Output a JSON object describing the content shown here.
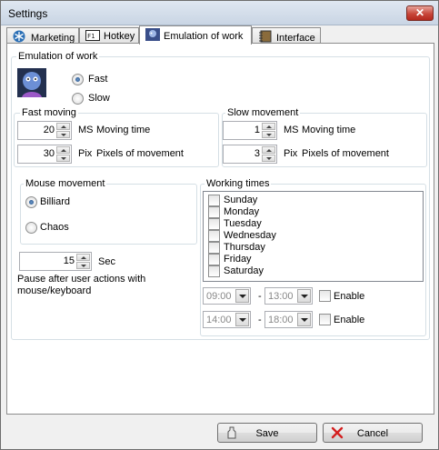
{
  "window": {
    "title": "Settings",
    "close_glyph": "✕"
  },
  "tabs": [
    {
      "label": "Marketing",
      "icon": "snowflake-icon"
    },
    {
      "label": "Hotkey",
      "icon": "keyboard-icon"
    },
    {
      "label": "Emulation of work",
      "icon": "robot-icon",
      "active": true
    },
    {
      "label": "Interface",
      "icon": "notebook-icon"
    }
  ],
  "emulation": {
    "title": "Emulation of work",
    "fast_label": "Fast",
    "slow_label": "Slow",
    "selected": "Fast"
  },
  "fast_moving": {
    "title": "Fast moving",
    "time_value": "20",
    "time_unit": "MS",
    "time_label": "Moving time",
    "pixels_value": "30",
    "pixels_unit": "Pix",
    "pixels_label": "Pixels of movement"
  },
  "slow_movement": {
    "title": "Slow movement",
    "time_value": "1",
    "time_unit": "MS",
    "time_label": "Moving time",
    "pixels_value": "3",
    "pixels_unit": "Pix",
    "pixels_label": "Pixels of movement"
  },
  "mouse_movement": {
    "title": "Mouse movement",
    "billiard_label": "Billiard",
    "chaos_label": "Chaos",
    "selected": "Billiard"
  },
  "pause": {
    "value": "15",
    "unit": "Sec",
    "label": "Pause after user actions with mouse/keyboard"
  },
  "working_times": {
    "title": "Working times",
    "days": [
      "Sunday",
      "Monday",
      "Tuesday",
      "Wednesday",
      "Thursday",
      "Friday",
      "Saturday"
    ],
    "range1": {
      "from": "09:00",
      "to": "13:00",
      "enable_label": "Enable"
    },
    "range2": {
      "from": "14:00",
      "to": "18:00",
      "enable_label": "Enable"
    },
    "separator": "-"
  },
  "buttons": {
    "save_label": "Save",
    "cancel_label": "Cancel"
  },
  "colors": {
    "accent": "#1f4c87",
    "close": "#c8463a",
    "cancel_x": "#d42020"
  }
}
